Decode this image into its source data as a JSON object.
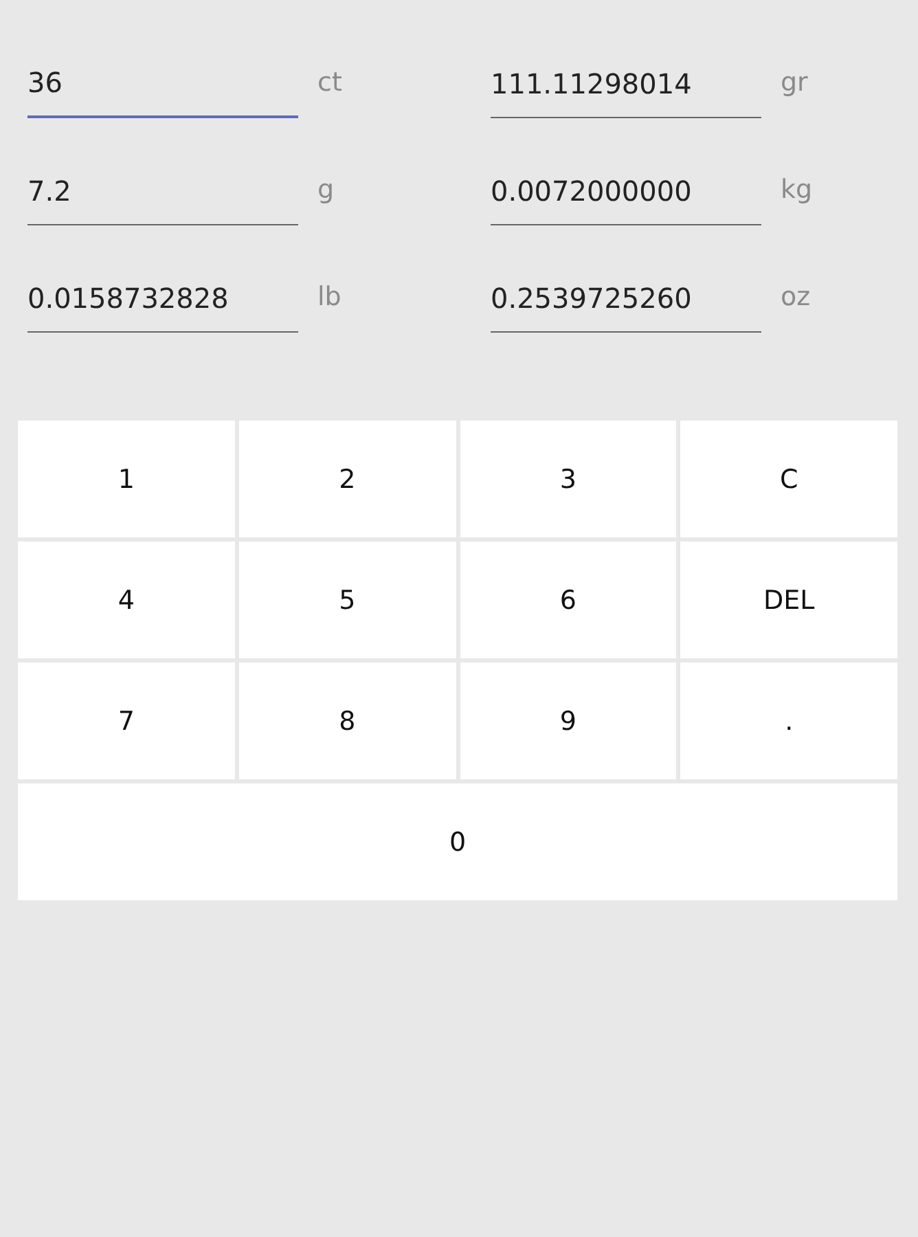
{
  "fields": [
    {
      "value": "36",
      "unit": "ct",
      "focused": true
    },
    {
      "value": "111.11298014",
      "unit": "gr",
      "focused": false
    },
    {
      "value": "7.2",
      "unit": "g",
      "focused": false
    },
    {
      "value": "0.0072000000",
      "unit": "kg",
      "focused": false
    },
    {
      "value": "0.0158732828",
      "unit": "lb",
      "focused": false
    },
    {
      "value": "0.2539725260",
      "unit": "oz",
      "focused": false
    }
  ],
  "keys": [
    {
      "label": "1",
      "kind": "normal"
    },
    {
      "label": "2",
      "kind": "normal"
    },
    {
      "label": "3",
      "kind": "normal"
    },
    {
      "label": "C",
      "kind": "normal"
    },
    {
      "label": "4",
      "kind": "normal"
    },
    {
      "label": "5",
      "kind": "normal"
    },
    {
      "label": "6",
      "kind": "normal"
    },
    {
      "label": "DEL",
      "kind": "normal"
    },
    {
      "label": "7",
      "kind": "normal"
    },
    {
      "label": "8",
      "kind": "normal"
    },
    {
      "label": "9",
      "kind": "normal"
    },
    {
      "label": ".",
      "kind": "normal"
    },
    {
      "label": "0",
      "kind": "wide"
    }
  ]
}
